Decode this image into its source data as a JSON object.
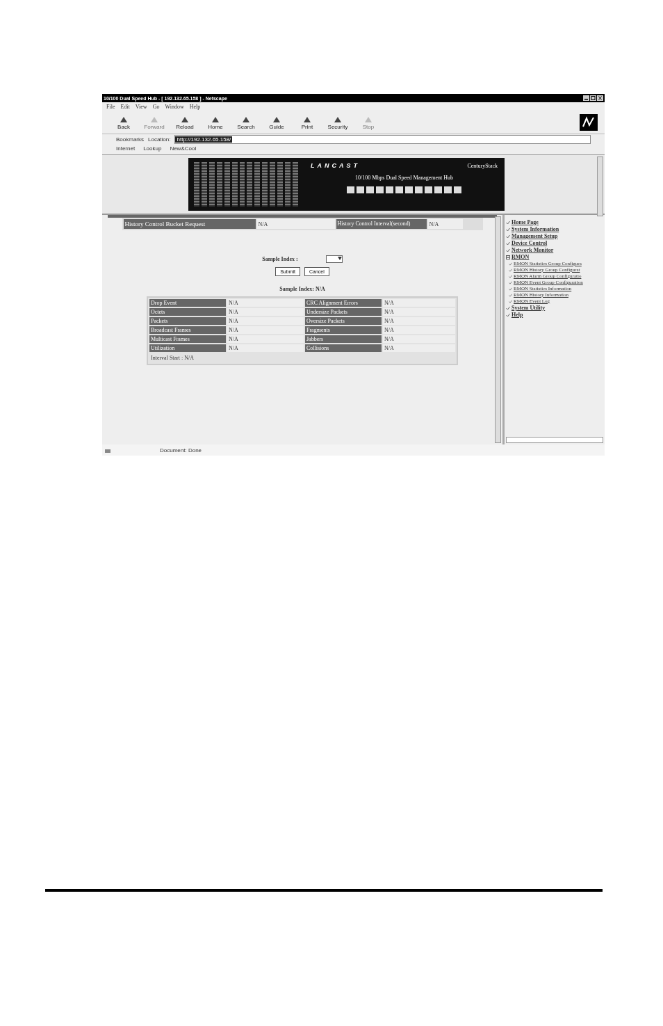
{
  "window": {
    "title": "10/100 Dual Speed Hub - [ 192.132.65.158 ] - Netscape"
  },
  "menu": [
    "File",
    "Edit",
    "View",
    "Go",
    "Window",
    "Help"
  ],
  "toolbar": [
    {
      "label": "Back",
      "disabled": false
    },
    {
      "label": "Forward",
      "disabled": true
    },
    {
      "label": "Reload",
      "disabled": false
    },
    {
      "label": "Home",
      "disabled": false
    },
    {
      "label": "Search",
      "disabled": false
    },
    {
      "label": "Guide",
      "disabled": false
    },
    {
      "label": "Print",
      "disabled": false
    },
    {
      "label": "Security",
      "disabled": false
    },
    {
      "label": "Stop",
      "disabled": true
    }
  ],
  "location_bar": {
    "bookmarks": "Bookmarks",
    "label": "Location:",
    "value": "http://192.132.65.158/"
  },
  "personal_bar": [
    "Internet",
    "Lookup",
    "New&Cool"
  ],
  "banner": {
    "brand": "LANCAST",
    "model": "CenturyStack",
    "caption": "10/100 Mbps Dual Speed Management Hub"
  },
  "history_row": [
    "History Control Bucket Request",
    "N/A",
    "History Control Interval(second)",
    "N/A"
  ],
  "sample_select": {
    "label": "Sample Index :"
  },
  "buttons": [
    "Submit",
    "Cancel"
  ],
  "sample_heading": "Sample Index: N/A",
  "stats": [
    [
      "Drop Event",
      "N/A",
      "CRC Alignment Errors",
      "N/A"
    ],
    [
      "Octets",
      "N/A",
      "Undersize Packets",
      "N/A"
    ],
    [
      "Packets",
      "N/A",
      "Oversize Packets",
      "N/A"
    ],
    [
      "Broadcast Frames",
      "N/A",
      "Fragments",
      "N/A"
    ],
    [
      "Multicast Frames",
      "N/A",
      "Jabbers",
      "N/A"
    ],
    [
      "Utilization",
      "N/A",
      "Collisions",
      "N/A"
    ]
  ],
  "interval_start": "Interval Start : N/A",
  "sidebar": [
    {
      "label": "Home Page"
    },
    {
      "label": "System Information"
    },
    {
      "label": "Management Setup"
    },
    {
      "label": "Device Control"
    },
    {
      "label": "Network Monitor"
    },
    {
      "label": "RMON",
      "expanded": true,
      "children": [
        {
          "label": "RMON Statistics Group Configura"
        },
        {
          "label": "RMON History Group Configurat"
        },
        {
          "label": "RMON Alarm Group Configuratio"
        },
        {
          "label": "RMON Event Group Configuration"
        },
        {
          "label": "RMON Statistics Information"
        },
        {
          "label": "RMON History Information"
        },
        {
          "label": "RMON Event Log"
        }
      ]
    },
    {
      "label": "System Utility"
    },
    {
      "label": "Help"
    }
  ],
  "status_bar": "Document: Done"
}
